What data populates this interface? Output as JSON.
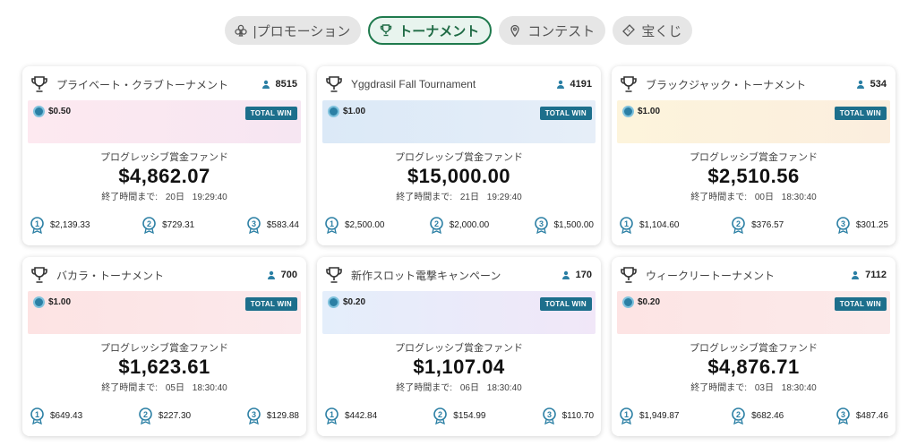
{
  "tabs": [
    {
      "label": "|プロモーション",
      "icon": "club-icon",
      "active": false
    },
    {
      "label": "トーナメント",
      "icon": "trophy-icon",
      "active": true
    },
    {
      "label": "コンテスト",
      "icon": "pin-icon",
      "active": false
    },
    {
      "label": "宝くじ",
      "icon": "ticket-icon",
      "active": false
    }
  ],
  "common": {
    "total_win": "TOTAL WIN",
    "fund_label": "プログレッシブ賞金ファンド",
    "ends_label": "終了時間まで:"
  },
  "colors": {
    "accent": "#1f7a4d",
    "badge": "#1d6f8c",
    "coin": "#2b7fa4"
  },
  "cards": [
    {
      "title": "プライベート・クラブトーナメント",
      "players": "8515",
      "stake": "$0.50",
      "fund": "$4,862.07",
      "days": "20日",
      "time": "19:29:40",
      "prizes": [
        "$2,139.33",
        "$729.31",
        "$583.44"
      ],
      "banner_colors": [
        "#fde9f0",
        "#f6e6f2"
      ]
    },
    {
      "title": "Yggdrasil Fall Tournament",
      "players": "4191",
      "stake": "$1.00",
      "fund": "$15,000.00",
      "days": "21日",
      "time": "19:29:40",
      "prizes": [
        "$2,500.00",
        "$2,000.00",
        "$1,500.00"
      ],
      "banner_colors": [
        "#dbe9f7",
        "#e6eef8"
      ]
    },
    {
      "title": "ブラックジャック・トーナメント",
      "players": "534",
      "stake": "$1.00",
      "fund": "$2,510.56",
      "days": "00日",
      "time": "18:30:40",
      "prizes": [
        "$1,104.60",
        "$376.57",
        "$301.25"
      ],
      "banner_colors": [
        "#fdf4dc",
        "#fbeede"
      ]
    },
    {
      "title": "バカラ・トーナメント",
      "players": "700",
      "stake": "$1.00",
      "fund": "$1,623.61",
      "days": "05日",
      "time": "18:30:40",
      "prizes": [
        "$649.43",
        "$227.30",
        "$129.88"
      ],
      "banner_colors": [
        "#fde3e3",
        "#fbe9ec"
      ]
    },
    {
      "title": "新作スロット電撃キャンペーン",
      "players": "170",
      "stake": "$0.20",
      "fund": "$1,107.04",
      "days": "06日",
      "time": "18:30:40",
      "prizes": [
        "$442.84",
        "$154.99",
        "$110.70"
      ],
      "banner_colors": [
        "#e4eefb",
        "#f1e7f8"
      ]
    },
    {
      "title": "ウィークリートーナメント",
      "players": "7112",
      "stake": "$0.20",
      "fund": "$4,876.71",
      "days": "03日",
      "time": "18:30:40",
      "prizes": [
        "$1,949.87",
        "$682.46",
        "$487.46"
      ],
      "banner_colors": [
        "#fde4e4",
        "#fbeaea"
      ]
    }
  ]
}
